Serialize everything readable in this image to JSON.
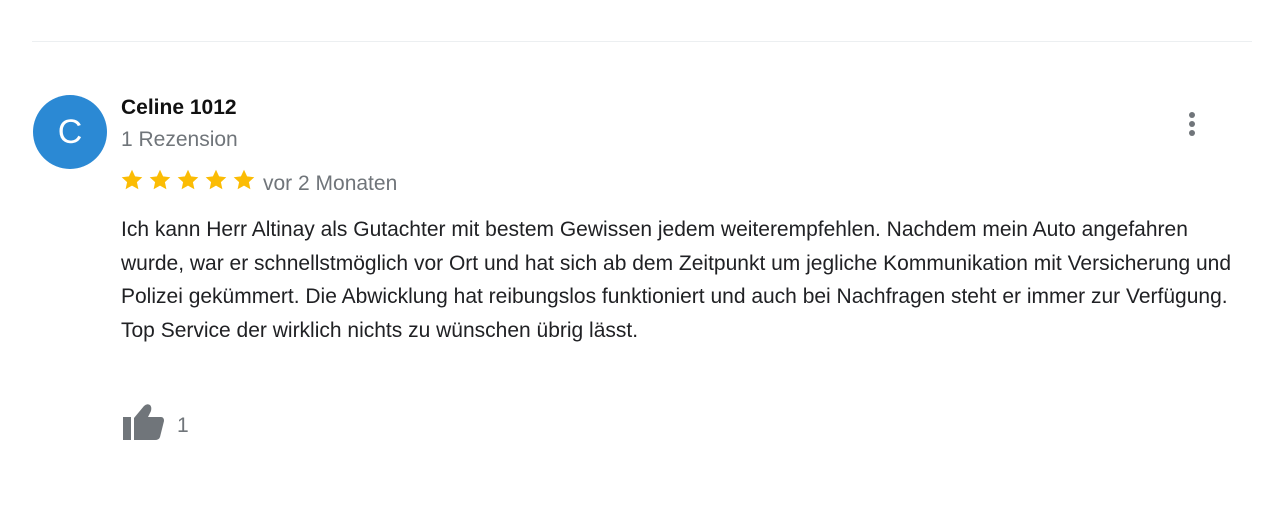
{
  "review": {
    "avatar_initial": "C",
    "avatar_color": "#2b89d4",
    "reviewer_name": "Celine 1012",
    "review_count": "1 Rezension",
    "rating": 5,
    "rating_max": 5,
    "star_color": "#fbbc04",
    "date": "vor 2 Monaten",
    "text": "Ich kann Herr Altinay als Gutachter mit bestem Gewissen jedem weiterempfehlen. Nachdem mein Auto angefahren wurde, war er schnellstmöglich vor Ort und hat sich ab dem Zeitpunkt um jegliche Kommunikation mit Versicherung und Polizei gekümmert. Die Abwicklung hat reibungslos funktioniert und auch bei Nachfragen steht er immer zur Verfügung. Top Service der wirklich nichts zu wünschen übrig lässt.",
    "like_count": "1",
    "icons": {
      "menu": "more-vert-icon",
      "like": "thumbs-up-icon",
      "star": "star-icon"
    }
  }
}
